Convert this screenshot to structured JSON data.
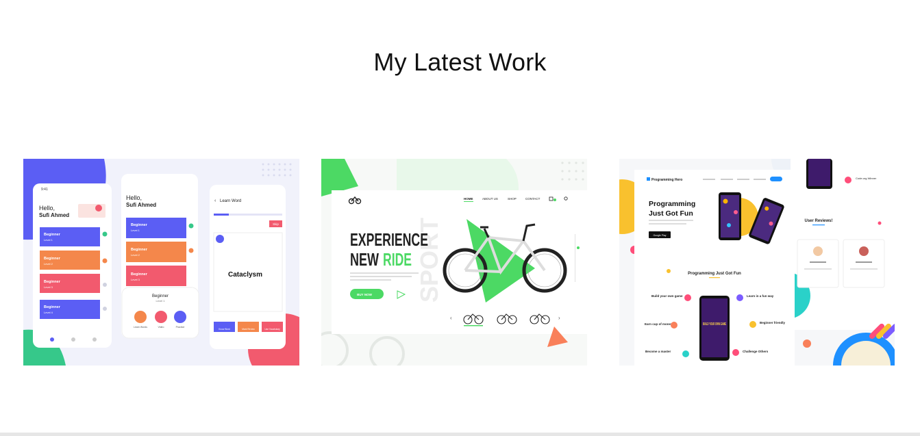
{
  "section": {
    "title": "My Latest Work"
  },
  "portfolio": [
    {
      "id": "learning-app",
      "greeting_1": "Hello,",
      "greeting_2": "Sufi Ahmed",
      "time": "9:41",
      "levels": [
        {
          "title": "Beginner",
          "sub": "Level 1"
        },
        {
          "title": "Beginner",
          "sub": "Level 2"
        },
        {
          "title": "Beginner",
          "sub": "Level 3"
        },
        {
          "title": "Beginner",
          "sub": "Level 4"
        }
      ],
      "levels_mid": [
        {
          "title": "Beginner",
          "sub": "Level 1"
        },
        {
          "title": "Beginner",
          "sub": "Level 2"
        },
        {
          "title": "Beginner",
          "sub": "Level 3"
        }
      ],
      "popup_title": "Beginner",
      "popup_sub": "Level 1",
      "popup_actions": [
        "Learn Words",
        "Video",
        "Practice"
      ],
      "learn_title": "Learn Word",
      "skip": "Skip",
      "word": "Cataclysm",
      "bottom_actions": [
        "Know Word",
        "Mark Review",
        "Use Vocabulary"
      ],
      "colors": {
        "purple": "#5b5ef4",
        "orange": "#f4874b",
        "pink": "#f25a6e",
        "green": "#36c88a"
      }
    },
    {
      "id": "bike-shop",
      "nav": [
        "HOME",
        "ABOUT US",
        "SHOP",
        "CONTACT"
      ],
      "headline_1": "EXPERIENCE",
      "headline_2a": "NEW",
      "headline_2b": "RIDE",
      "watermark": "SPORT",
      "cta": "BUY NOW",
      "colors": {
        "green": "#4cd964",
        "dark": "#222222"
      }
    },
    {
      "id": "programming-hero",
      "brand": "Programming Hero",
      "hero_title_1": "Programming",
      "hero_title_2": "Just Got Fun",
      "store_badge": "Google Play",
      "section_title": "Programming Just Got Fun",
      "features_left": [
        "Build your own game",
        "Earn cup of money",
        "Become a master"
      ],
      "features_right": [
        "Learn in a fun way",
        "Beginner friendly",
        "Challenge Others"
      ],
      "game_title": "BUILD YOUR OWN GAME",
      "review_title": "User Reviews!",
      "side_label": "Code.org Winner",
      "colors": {
        "yellow": "#f9c12e",
        "pink": "#ff4e7a",
        "blue": "#1e90ff"
      }
    }
  ]
}
